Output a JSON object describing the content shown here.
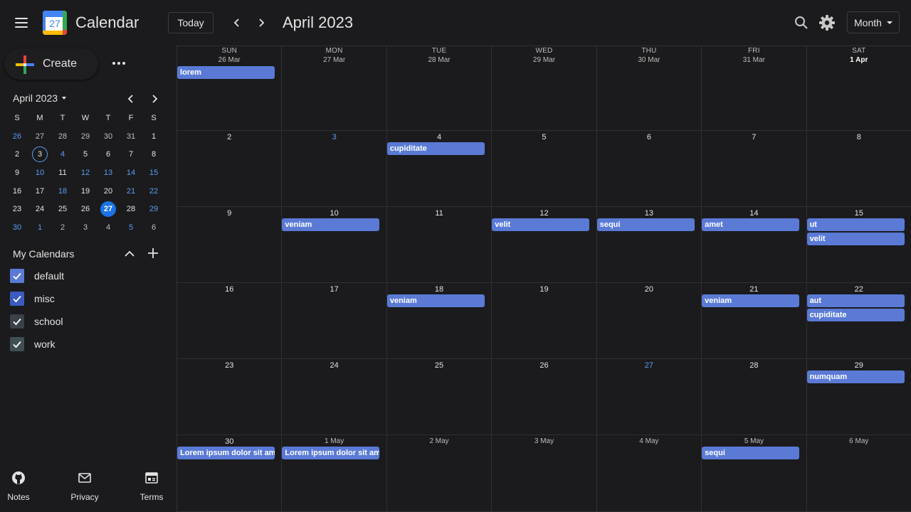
{
  "header": {
    "app_title": "Calendar",
    "logo_day": "27",
    "today_label": "Today",
    "period_title": "April 2023",
    "view_mode": "Month"
  },
  "sidebar": {
    "create_label": "Create",
    "mini_calendar": {
      "title": "April 2023",
      "weekday_headers": [
        "S",
        "M",
        "T",
        "W",
        "T",
        "F",
        "S"
      ],
      "weeks": [
        [
          {
            "d": "26",
            "s": "blue"
          },
          {
            "d": "27",
            "s": "dim"
          },
          {
            "d": "28",
            "s": "dim"
          },
          {
            "d": "29",
            "s": "dim"
          },
          {
            "d": "30",
            "s": "dim"
          },
          {
            "d": "31",
            "s": "dim"
          },
          {
            "d": "1",
            "s": ""
          }
        ],
        [
          {
            "d": "2",
            "s": ""
          },
          {
            "d": "3",
            "s": "today"
          },
          {
            "d": "4",
            "s": "blue"
          },
          {
            "d": "5",
            "s": ""
          },
          {
            "d": "6",
            "s": ""
          },
          {
            "d": "7",
            "s": ""
          },
          {
            "d": "8",
            "s": ""
          }
        ],
        [
          {
            "d": "9",
            "s": ""
          },
          {
            "d": "10",
            "s": "blue"
          },
          {
            "d": "11",
            "s": ""
          },
          {
            "d": "12",
            "s": "blue"
          },
          {
            "d": "13",
            "s": "blue"
          },
          {
            "d": "14",
            "s": "blue"
          },
          {
            "d": "15",
            "s": "blue"
          }
        ],
        [
          {
            "d": "16",
            "s": ""
          },
          {
            "d": "17",
            "s": ""
          },
          {
            "d": "18",
            "s": "blue"
          },
          {
            "d": "19",
            "s": ""
          },
          {
            "d": "20",
            "s": ""
          },
          {
            "d": "21",
            "s": "blue"
          },
          {
            "d": "22",
            "s": "blue"
          }
        ],
        [
          {
            "d": "23",
            "s": ""
          },
          {
            "d": "24",
            "s": ""
          },
          {
            "d": "25",
            "s": ""
          },
          {
            "d": "26",
            "s": ""
          },
          {
            "d": "27",
            "s": "sel"
          },
          {
            "d": "28",
            "s": ""
          },
          {
            "d": "29",
            "s": "blue"
          }
        ],
        [
          {
            "d": "30",
            "s": "blue"
          },
          {
            "d": "1",
            "s": "blue"
          },
          {
            "d": "2",
            "s": "dim"
          },
          {
            "d": "3",
            "s": "dim"
          },
          {
            "d": "4",
            "s": "dim"
          },
          {
            "d": "5",
            "s": "blue"
          },
          {
            "d": "6",
            "s": "dim"
          }
        ]
      ]
    },
    "my_calendars_title": "My Calendars",
    "calendars": [
      {
        "name": "default",
        "color": "#5a7ad6"
      },
      {
        "name": "misc",
        "color": "#3b5bc0"
      },
      {
        "name": "school",
        "color": "#3a4148"
      },
      {
        "name": "work",
        "color": "#3f5055"
      }
    ],
    "footer": [
      {
        "label": "Notes",
        "icon": "github-icon"
      },
      {
        "label": "Privacy",
        "icon": "mail-icon"
      },
      {
        "label": "Terms",
        "icon": "terms-icon"
      }
    ]
  },
  "month_grid": {
    "weekday_headers": [
      "SUN",
      "MON",
      "TUE",
      "WED",
      "THU",
      "FRI",
      "SAT"
    ],
    "weeks": [
      [
        {
          "label": "26 Mar",
          "style": "other",
          "events": [
            "lorem"
          ]
        },
        {
          "label": "27 Mar",
          "style": "other",
          "events": []
        },
        {
          "label": "28 Mar",
          "style": "other",
          "events": []
        },
        {
          "label": "29 Mar",
          "style": "other",
          "events": []
        },
        {
          "label": "30 Mar",
          "style": "other",
          "events": []
        },
        {
          "label": "31 Mar",
          "style": "other",
          "events": []
        },
        {
          "label": "1 Apr",
          "style": "bold",
          "events": []
        }
      ],
      [
        {
          "label": "2",
          "style": "",
          "events": []
        },
        {
          "label": "3",
          "style": "blue",
          "events": []
        },
        {
          "label": "4",
          "style": "",
          "events": [
            "cupiditate"
          ]
        },
        {
          "label": "5",
          "style": "",
          "events": []
        },
        {
          "label": "6",
          "style": "",
          "events": []
        },
        {
          "label": "7",
          "style": "",
          "events": []
        },
        {
          "label": "8",
          "style": "",
          "events": []
        }
      ],
      [
        {
          "label": "9",
          "style": "",
          "events": []
        },
        {
          "label": "10",
          "style": "",
          "events": [
            "veniam"
          ]
        },
        {
          "label": "11",
          "style": "",
          "events": []
        },
        {
          "label": "12",
          "style": "",
          "events": [
            "velit"
          ]
        },
        {
          "label": "13",
          "style": "",
          "events": [
            "sequi"
          ]
        },
        {
          "label": "14",
          "style": "",
          "events": [
            "amet"
          ]
        },
        {
          "label": "15",
          "style": "",
          "events": [
            "ut",
            "velit"
          ]
        }
      ],
      [
        {
          "label": "16",
          "style": "",
          "events": []
        },
        {
          "label": "17",
          "style": "",
          "events": []
        },
        {
          "label": "18",
          "style": "",
          "events": [
            "veniam"
          ]
        },
        {
          "label": "19",
          "style": "",
          "events": []
        },
        {
          "label": "20",
          "style": "",
          "events": []
        },
        {
          "label": "21",
          "style": "",
          "events": [
            "veniam"
          ]
        },
        {
          "label": "22",
          "style": "",
          "events": [
            "aut",
            "cupiditate"
          ]
        }
      ],
      [
        {
          "label": "23",
          "style": "",
          "events": []
        },
        {
          "label": "24",
          "style": "",
          "events": []
        },
        {
          "label": "25",
          "style": "",
          "events": []
        },
        {
          "label": "26",
          "style": "",
          "events": []
        },
        {
          "label": "27",
          "style": "blue",
          "events": []
        },
        {
          "label": "28",
          "style": "",
          "events": []
        },
        {
          "label": "29",
          "style": "",
          "events": [
            "numquam"
          ]
        }
      ],
      [
        {
          "label": "30",
          "style": "",
          "events": [
            "Lorem ipsum dolor sit amet"
          ]
        },
        {
          "label": "1 May",
          "style": "other",
          "events": [
            "Lorem ipsum dolor sit amet"
          ]
        },
        {
          "label": "2 May",
          "style": "other",
          "events": []
        },
        {
          "label": "3 May",
          "style": "other",
          "events": []
        },
        {
          "label": "4 May",
          "style": "other",
          "events": []
        },
        {
          "label": "5 May",
          "style": "other",
          "events": [
            "sequi"
          ]
        },
        {
          "label": "6 May",
          "style": "other",
          "events": []
        }
      ]
    ]
  },
  "colors": {
    "event": "#5a7ad6",
    "accent": "#1a73e8",
    "link_blue": "#5b9cf5"
  }
}
